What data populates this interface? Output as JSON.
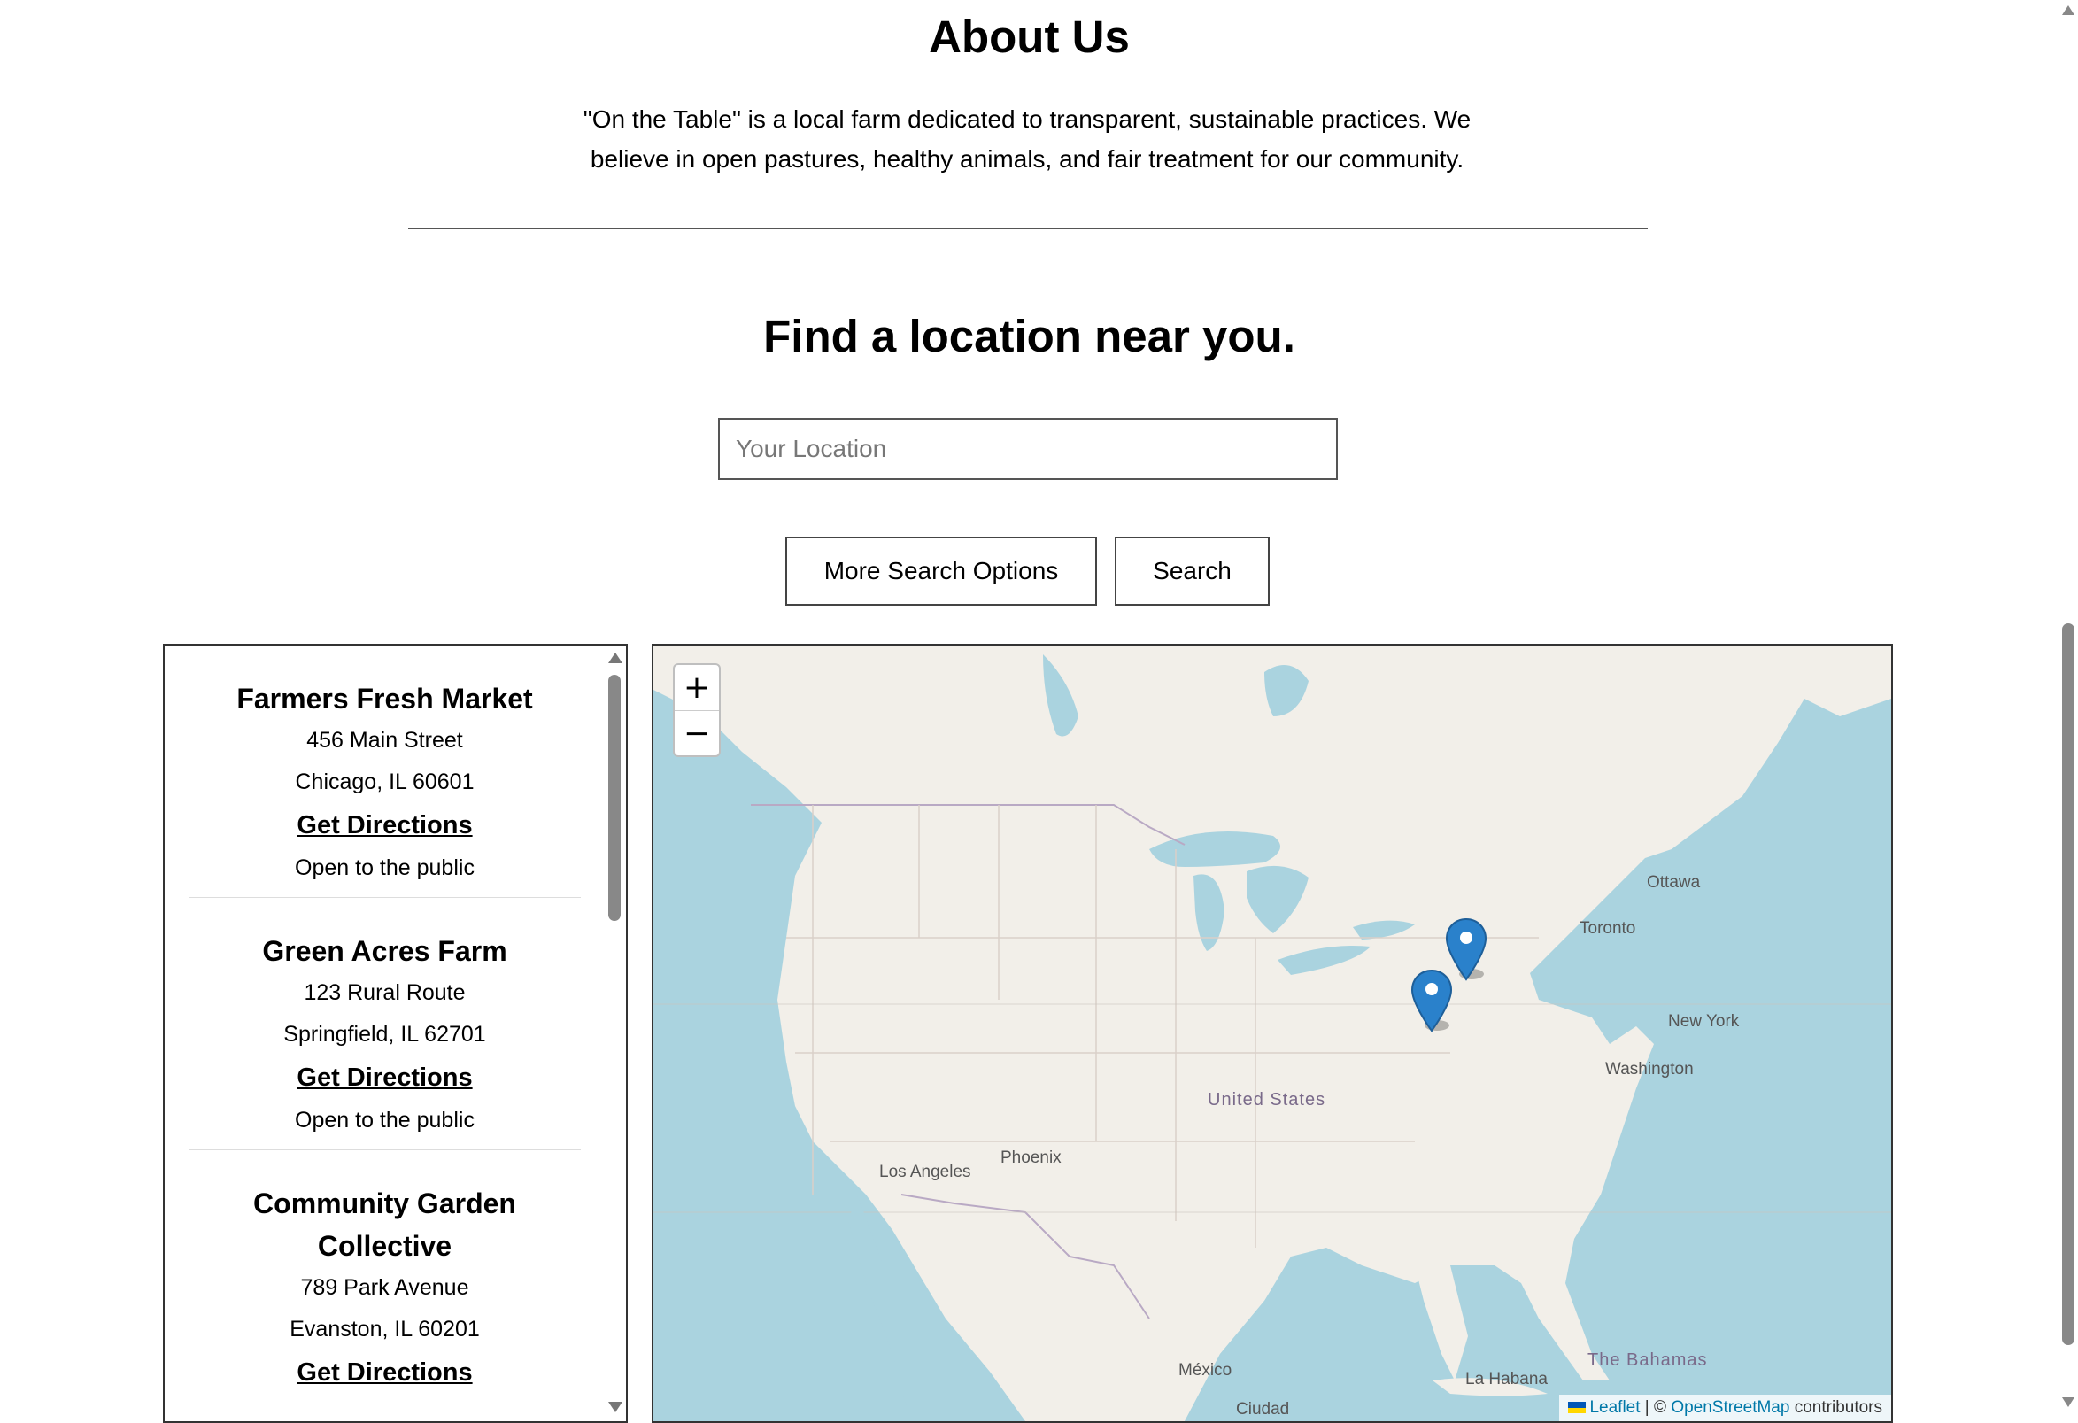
{
  "about": {
    "title": "About Us",
    "text": "\"On the Table\" is a local farm dedicated to transparent, sustainable practices. We believe in open pastures, healthy animals, and fair treatment for our community."
  },
  "finder": {
    "title": "Find a location near you.",
    "location_placeholder": "Your Location",
    "more_options_label": "More Search Options",
    "search_label": "Search"
  },
  "locations": [
    {
      "name": "Farmers Fresh Market",
      "street": "456 Main Street",
      "city": "Chicago, IL 60601",
      "link": "Get Directions",
      "access": "Open to the public"
    },
    {
      "name": "Green Acres Farm",
      "street": "123 Rural Route",
      "city": "Springfield, IL 62701",
      "link": "Get Directions",
      "access": "Open to the public"
    },
    {
      "name": "Community Garden Collective",
      "street": "789 Park Avenue",
      "city": "Evanston, IL 60201",
      "link": "Get Directions",
      "access": ""
    }
  ],
  "map": {
    "zoom_in": "+",
    "zoom_out": "−",
    "attribution": {
      "leaflet": "Leaflet",
      "separator": " | © ",
      "osm": "OpenStreetMap",
      "suffix": " contributors"
    },
    "labels": {
      "ottawa": "Ottawa",
      "toronto": "Toronto",
      "new_york": "New York",
      "washington": "Washington",
      "united_states": "United States",
      "phoenix": "Phoenix",
      "los_angeles": "Los Angeles",
      "mexico": "México",
      "la_habana": "La Habana",
      "bahamas": "The Bahamas",
      "ciudad": "Ciudad"
    },
    "colors": {
      "water": "#aad3df",
      "land": "#f2efe9",
      "marker": "#2a81cb"
    }
  },
  "icons": {
    "flag": "ukraine-flag-icon",
    "marker": "map-marker-icon"
  }
}
